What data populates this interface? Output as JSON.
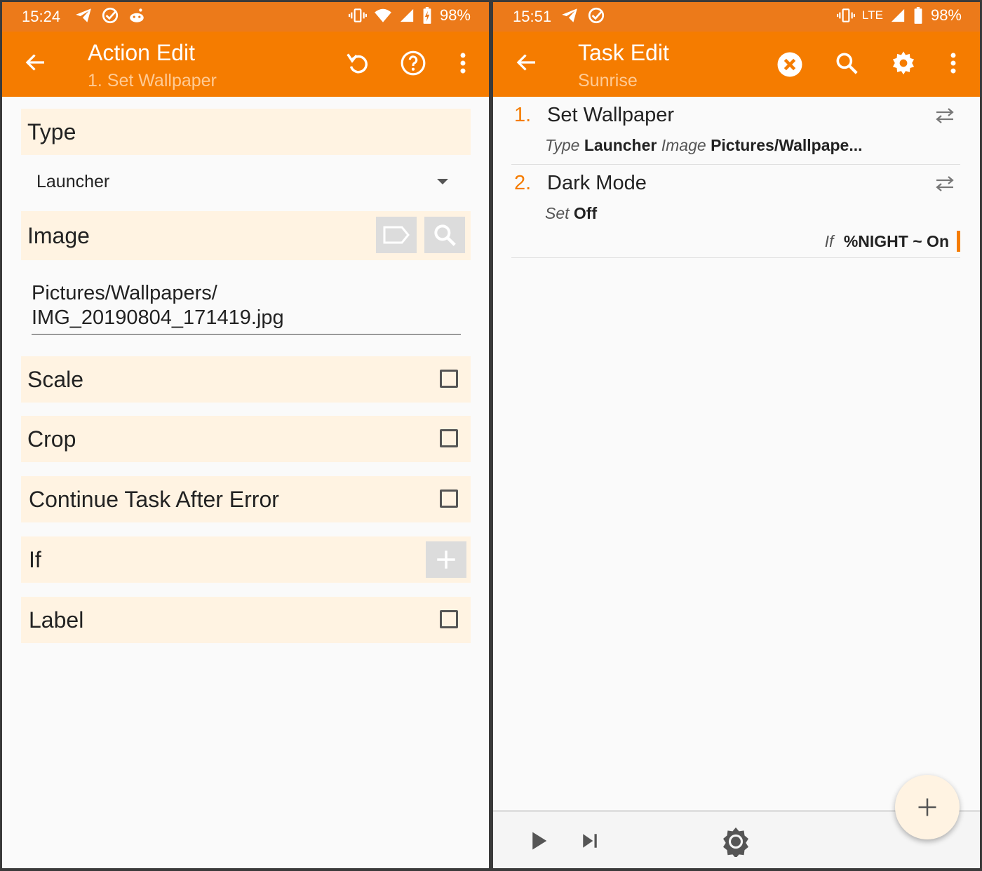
{
  "left_screen": {
    "status": {
      "time": "15:24",
      "battery": "98%"
    },
    "appbar": {
      "title": "Action Edit",
      "subtitle": "1. Set Wallpaper"
    },
    "type": {
      "label": "Type",
      "value": "Launcher"
    },
    "image": {
      "label": "Image",
      "path_line1": "Pictures/Wallpapers/",
      "path_line2": "IMG_20190804_171419.jpg"
    },
    "options": {
      "scale": "Scale",
      "crop": "Crop",
      "continue": "Continue Task After Error",
      "if": "If",
      "label": "Label"
    }
  },
  "right_screen": {
    "status": {
      "time": "15:51",
      "network": "LTE",
      "battery": "98%"
    },
    "appbar": {
      "title": "Task Edit",
      "subtitle": "Sunrise"
    },
    "actions": [
      {
        "num": "1.",
        "name": "Set Wallpaper",
        "arg1_label": "Type",
        "arg1_value": "Launcher",
        "arg2_label": "Image",
        "arg2_value": "Pictures/Wallpape..."
      },
      {
        "num": "2.",
        "name": "Dark Mode",
        "arg1_label": "Set",
        "arg1_value": "Off",
        "cond_label": "If",
        "cond_value": "%NIGHT ~ On"
      }
    ]
  },
  "colors": {
    "accent": "#f57c00",
    "status_bar": "#ec7a1a",
    "row_bg": "#fff3e2"
  },
  "icons": [
    "back-arrow-icon",
    "undo-icon",
    "help-icon",
    "more-vert-icon",
    "clear-icon",
    "search-icon",
    "settings-icon",
    "swap-icon",
    "play-icon",
    "skip-next-icon",
    "brightness-icon",
    "add-icon"
  ]
}
